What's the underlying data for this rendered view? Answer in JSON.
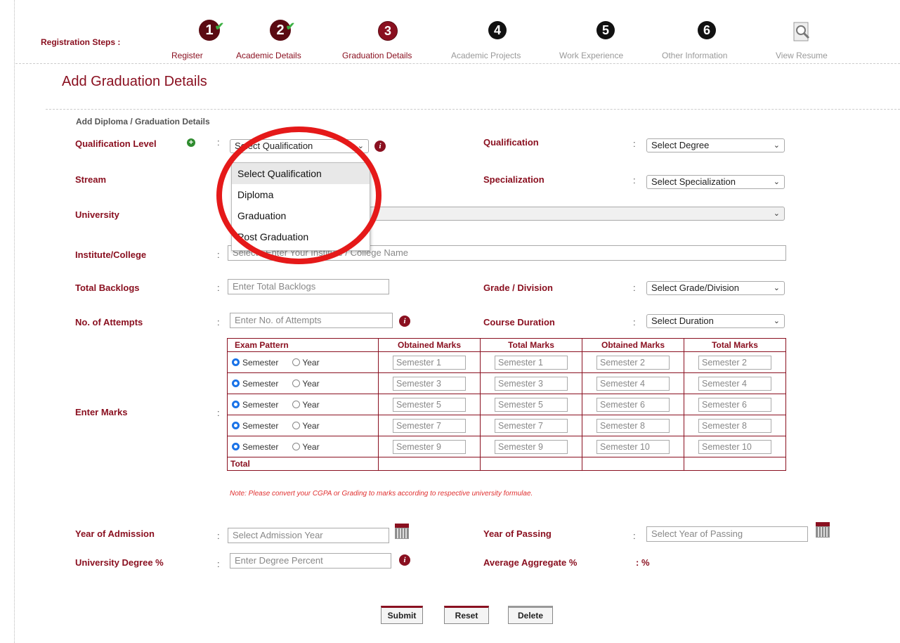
{
  "steps": {
    "label": "Registration Steps :",
    "items": [
      {
        "num": "1",
        "label": "Register",
        "state": "done"
      },
      {
        "num": "2",
        "label": "Academic Details",
        "state": "done"
      },
      {
        "num": "3",
        "label": "Graduation Details",
        "state": "current"
      },
      {
        "num": "4",
        "label": "Academic Projects",
        "state": "todo"
      },
      {
        "num": "5",
        "label": "Work Experience",
        "state": "todo"
      },
      {
        "num": "6",
        "label": "Other Information",
        "state": "todo"
      },
      {
        "num": "",
        "label": "View Resume",
        "state": "view"
      }
    ]
  },
  "page_title": "Add Graduation Details",
  "section_title": "Add Diploma / Graduation Details",
  "fields": {
    "qualification_level": {
      "label": "Qualification Level",
      "value": "Select Qualification"
    },
    "qualification": {
      "label": "Qualification",
      "value": "Select Degree"
    },
    "stream": {
      "label": "Stream"
    },
    "specialization": {
      "label": "Specialization",
      "value": "Select Specialization"
    },
    "university": {
      "label": "University"
    },
    "institute": {
      "label": "Institute/College",
      "placeholder": "Select / Enter Your Institute / College Name"
    },
    "total_backlogs": {
      "label": "Total Backlogs",
      "placeholder": "Enter Total Backlogs"
    },
    "grade_division": {
      "label": "Grade / Division",
      "value": "Select Grade/Division"
    },
    "attempts": {
      "label": "No. of Attempts",
      "placeholder": "Enter No. of Attempts"
    },
    "course_duration": {
      "label": "Course Duration",
      "value": "Select Duration"
    },
    "enter_marks": {
      "label": "Enter Marks"
    },
    "year_admission": {
      "label": "Year of Admission",
      "placeholder": "Select Admission Year"
    },
    "year_passing": {
      "label": "Year of Passing",
      "placeholder": "Select Year of Passing"
    },
    "degree_percent": {
      "label": "University Degree %",
      "placeholder": "Enter Degree Percent"
    },
    "average_aggregate": {
      "label": "Average Aggregate %",
      "value": ": %"
    }
  },
  "marks_table": {
    "headers": [
      "Exam Pattern",
      "Obtained Marks",
      "Total Marks",
      "Obtained Marks",
      "Total Marks"
    ],
    "radio_semester": "Semester",
    "radio_year": "Year",
    "rows": [
      [
        "Semester 1",
        "Semester 1",
        "Semester 2",
        "Semester 2"
      ],
      [
        "Semester 3",
        "Semester 3",
        "Semester 4",
        "Semester 4"
      ],
      [
        "Semester 5",
        "Semester 5",
        "Semester 6",
        "Semester 6"
      ],
      [
        "Semester 7",
        "Semester 7",
        "Semester 8",
        "Semester 8"
      ],
      [
        "Semester 9",
        "Semester 9",
        "Semester 10",
        "Semester 10"
      ]
    ],
    "total_label": "Total"
  },
  "note": "Note: Please convert your CGPA or Grading to marks according to respective university formulae.",
  "dropdown": {
    "options": [
      "Select Qualification",
      "Diploma",
      "Graduation",
      "Post Graduation"
    ]
  },
  "buttons": {
    "submit": "Submit",
    "reset": "Reset",
    "delete": "Delete"
  },
  "colors": {
    "brand": "#8a1020",
    "highlight": "#e51919",
    "note": "#e03030"
  }
}
